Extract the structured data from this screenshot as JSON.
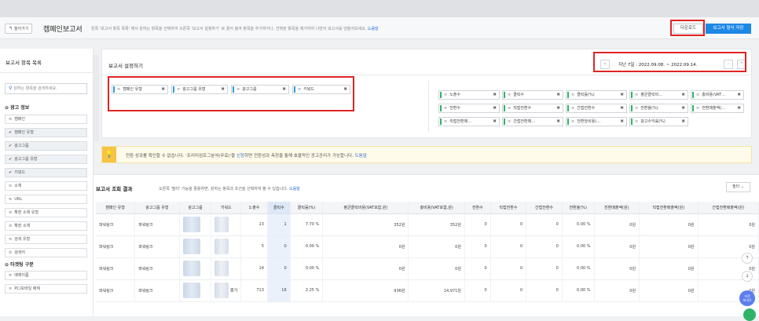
{
  "header": {
    "back_label": "돌아가기",
    "title": "캠페인보고서",
    "description": "왼쪽 '보고서 항목 목록' 에서 원하는 항목을 선택하여 오른쪽 '보고서 설정하기' 로 끌어 옮겨 항목을 추가하거나, 선택된 항목을 제거하여 나만의 보고서를 만들어보세요.",
    "help_link": "도움말",
    "download_label": "다운로드",
    "save_format_label": "보고서 형식 저장"
  },
  "sidebar": {
    "title": "보고서 항목 목록",
    "search_placeholder": "원하는 항목을 검색하세요.",
    "groups": [
      {
        "label": "광고 정보",
        "items": [
          {
            "label": "캠페인",
            "checked": false
          },
          {
            "label": "캠페인 유형",
            "checked": true
          },
          {
            "label": "광고그룹",
            "checked": true
          },
          {
            "label": "광고그룹 유형",
            "checked": true
          },
          {
            "label": "키워드",
            "checked": true
          },
          {
            "label": "소재",
            "checked": false
          },
          {
            "label": "URL",
            "checked": false
          },
          {
            "label": "확장 소재 유형",
            "checked": false
          },
          {
            "label": "확장 소재",
            "checked": false
          },
          {
            "label": "검색 유형",
            "checked": false
          },
          {
            "label": "검색어",
            "checked": false
          }
        ]
      },
      {
        "label": "타겟팅 구분",
        "items": [
          {
            "label": "매체이름",
            "checked": false
          },
          {
            "label": "PC/모바일 매체",
            "checked": false
          }
        ]
      }
    ]
  },
  "settings": {
    "title": "보고서 설정하기",
    "date_range": "지난 7일 : 2022.09.08. ~ 2022.09.14.",
    "prev_icon": "‹",
    "next_icon": "›",
    "collapse_icon": "^",
    "dimensions": [
      "캠페인 유형",
      "광고그룹 유형",
      "광고그룹",
      "키워드"
    ],
    "metrics": [
      [
        "노출수",
        "클릭수",
        "클릭률(%)",
        "평균클릭비…",
        "총비용(VAT…"
      ],
      [
        "전환수",
        "직접전환수",
        "간접전환수",
        "전환율(%)",
        "전환매출액(…"
      ],
      [
        "직접전환매…",
        "간접전환매…",
        "전환당비용(…",
        "광고수익률(%)"
      ]
    ]
  },
  "notice": {
    "icon": "lightbulb-icon",
    "text_before": "전환 성과를 확인할 수 없습니다. '프리미엄로그분석(무료)'을 ",
    "link": "신청",
    "text_after": "하면 전환성과 측정을 통해 효율적인 광고관리가 가능합니다. ",
    "help_link": "도움말"
  },
  "results": {
    "title": "보고서 조회 결과",
    "description": "오른쪽 '필터' 기능을 활용하면, 원하는 항목과 조건을 선택하여 볼 수 있습니다.",
    "help_link": "도움말",
    "filter_label": "필터",
    "columns": [
      "캠페인 유형",
      "광고그룹 유형",
      "광고그룹",
      "키워드",
      "노출수",
      "클릭수",
      "클릭률(%)",
      "평균클릭비용(VAT포함,원)",
      "총비용(VAT포함,원)",
      "전환수",
      "직접전환수",
      "간접전환수",
      "전환율(%)",
      "전환매출액(원)",
      "직접전환매출액(원)",
      "간접전환매출액(원)"
    ],
    "rows": [
      [
        "파워링크",
        "파워링크",
        "",
        "",
        "13",
        "1",
        "7.70 %",
        "352원",
        "352원",
        "0",
        "0",
        "0",
        "0.00 %",
        "0원",
        "0원",
        "0원"
      ],
      [
        "파워링크",
        "파워링크",
        "",
        "",
        "5",
        "0",
        "0.00 %",
        "0원",
        "0원",
        "0",
        "0",
        "0",
        "0.00 %",
        "0원",
        "0원",
        "0원"
      ],
      [
        "파워링크",
        "파워링크",
        "",
        "",
        "14",
        "0",
        "0.00 %",
        "0원",
        "0원",
        "0",
        "0",
        "0",
        "0.00 %",
        "0원",
        "0원",
        "0원"
      ],
      [
        "파워링크",
        "파워링크",
        "",
        "",
        "713",
        "16",
        "2.25 %",
        "936원",
        "14,971원",
        "0",
        "0",
        "0",
        "0.00 %",
        "0원",
        "0원",
        "0원"
      ]
    ],
    "partial_keyword": "좀거"
  },
  "floating": {
    "scroll_up": "↑",
    "scroll_down": "↓",
    "chat_label_1": "의견",
    "chat_label_2": "보내기"
  }
}
